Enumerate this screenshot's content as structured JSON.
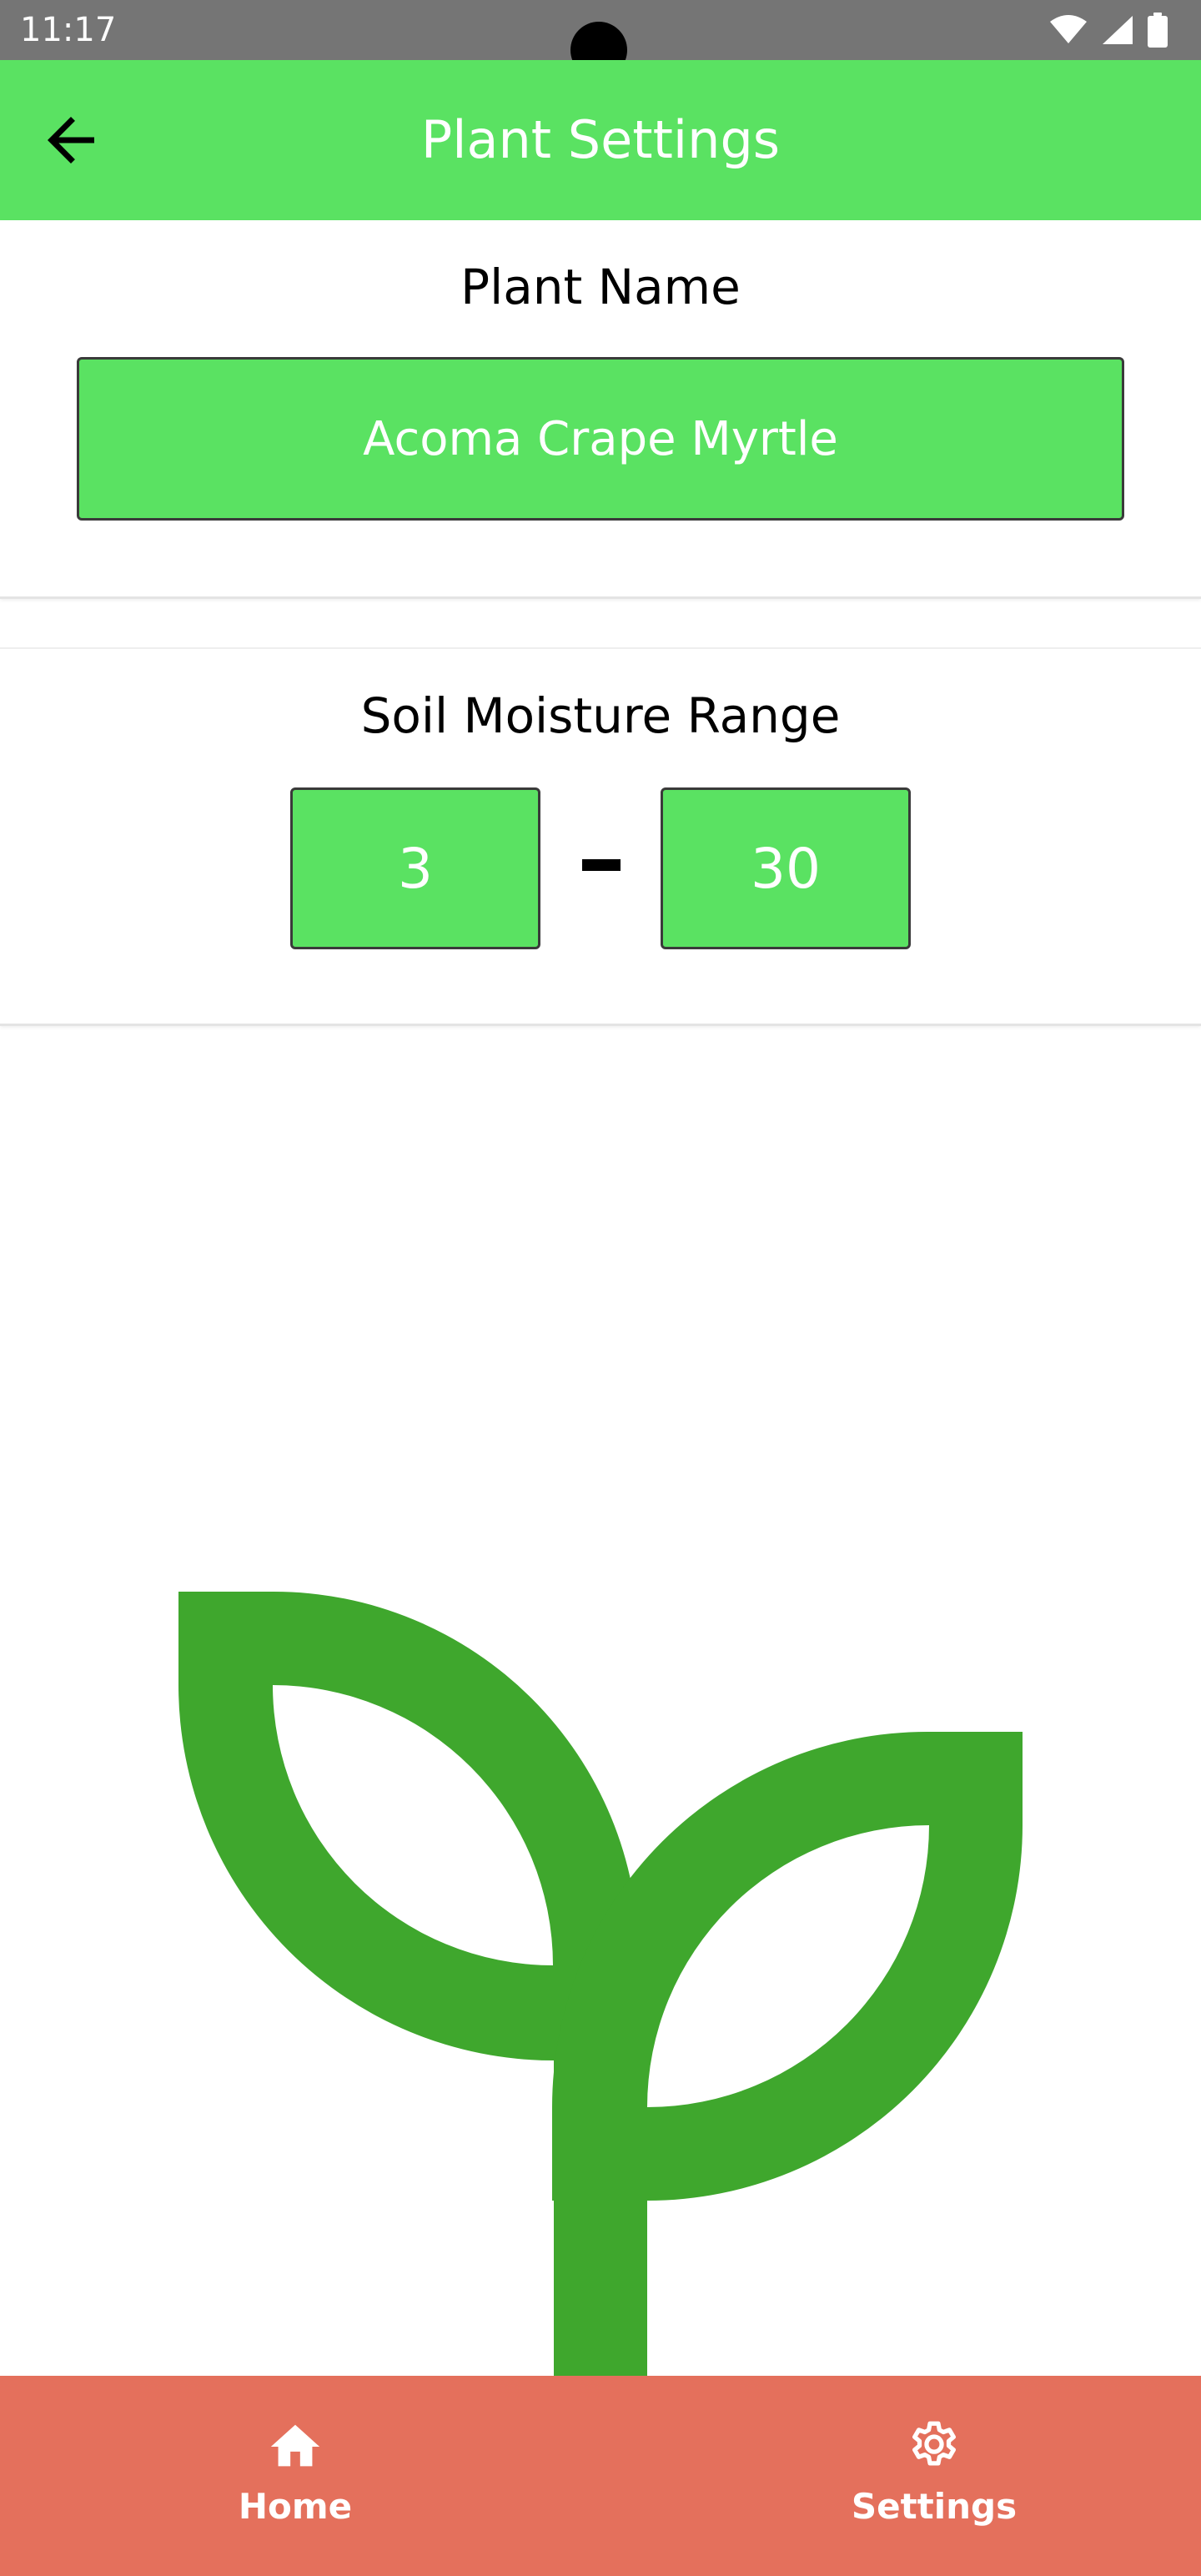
{
  "status_bar": {
    "time": "11:17",
    "icons": [
      "wifi-icon",
      "cellular-signal-icon",
      "battery-icon"
    ]
  },
  "app_bar": {
    "title": "Plant Settings",
    "back_icon": "arrow-back-icon"
  },
  "plant_name_card": {
    "title": "Plant Name",
    "value": "Acoma Crape Myrtle"
  },
  "soil_moisture_card": {
    "title": "Soil Moisture Range",
    "min": "3",
    "max": "30",
    "separator": "-"
  },
  "illustration": {
    "icon": "sprout-icon",
    "color": "#3fa72d"
  },
  "bottom_nav": {
    "items": [
      {
        "label": "Home",
        "icon": "home-icon"
      },
      {
        "label": "Settings",
        "icon": "gear-icon"
      }
    ]
  },
  "colors": {
    "status_bar": "#757575",
    "primary_green": "#5ae262",
    "illustration_green": "#3fa72d",
    "bottom_nav": "#e4705c",
    "text_on_primary": "#ffffff"
  }
}
